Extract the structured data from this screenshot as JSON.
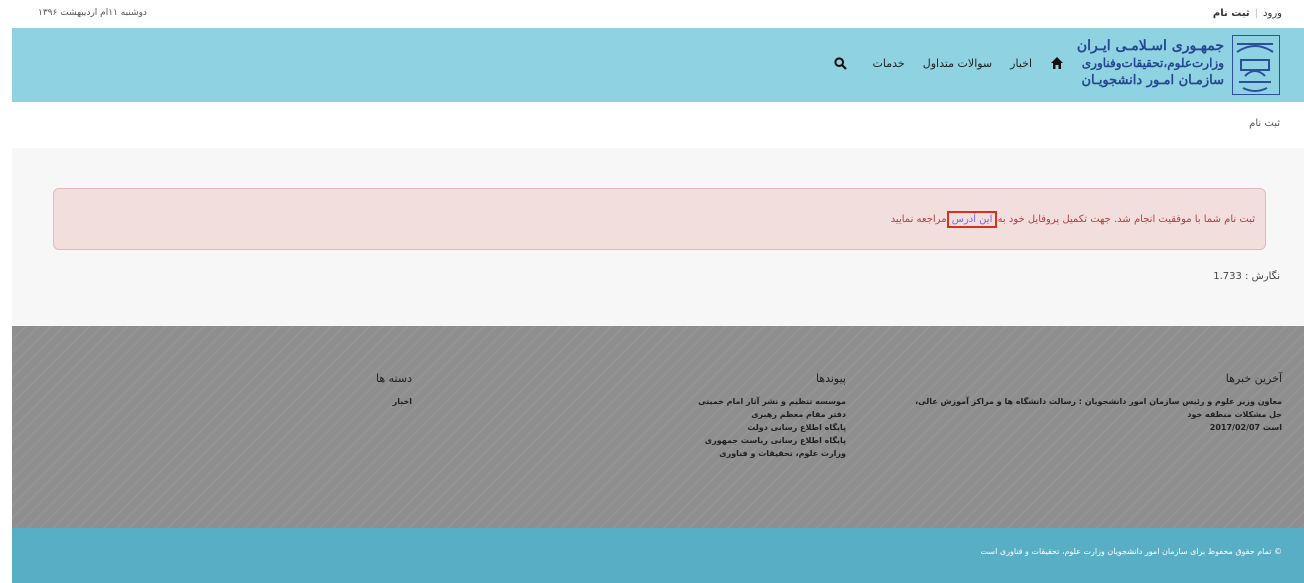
{
  "topbar": {
    "login_link": "ورود",
    "register_link": "ثبت نام",
    "date": "دوشنبه ۱۱ام اردیبهشت ۱۳۹۶"
  },
  "header": {
    "logo_line1": "جمهـوری اسـلامـی ایـران",
    "logo_line2": "وزارت‌علوم،تحقیقات‌وفناوری",
    "logo_line3": "سازمـان امـور دانشجویـان",
    "nav": {
      "home_icon": "home-icon",
      "news": "اخبار",
      "faq": "سوالات متداول",
      "services": "خدمات",
      "search_icon": "search-icon"
    }
  },
  "page": {
    "title": "ثبت نام",
    "alert_before": "ثبت نام شما با موفقیت انجام شد. جهت تکمیل پروفایل خود به",
    "alert_link": "این آدرس",
    "alert_after": "مراجعه نمایید",
    "render_label": "نگارش : 1.733"
  },
  "footer": {
    "news": {
      "heading": "آخرین خبرها",
      "items": [
        "معاون وزیر علوم و رئیس سازمان امور دانشجویان : رسالت دانشگاه ها و مراکز آموزش عالی، حل مشکلات منطقه خود",
        "است 2017/02/07"
      ]
    },
    "links": {
      "heading": "پیوندها",
      "items": [
        "موسسه تنظیم و نشر آثار امام خمینی",
        "دفتر مقام معظم رهبری",
        "پایگاه اطلاع رسانی دولت",
        "پایگاه اطلاع رسانی ریاست جمهوری",
        "وزارت علوم، تحقیقات و فناوری"
      ]
    },
    "categories": {
      "heading": "دسته ها",
      "items": [
        "اخبار"
      ]
    }
  },
  "copyright": "© تمام حقوق محفوظ برای سازمان امور دانشجویان وزارت علوم، تحقیقات و فناوری است",
  "colors": {
    "header_bg": "#8fd3e3",
    "footer_bg": "#8e8e8e",
    "copyright_bg": "#58aec4",
    "alert_bg": "#f3dede",
    "alert_text": "#b0413e",
    "logo_blue": "#25478f"
  }
}
